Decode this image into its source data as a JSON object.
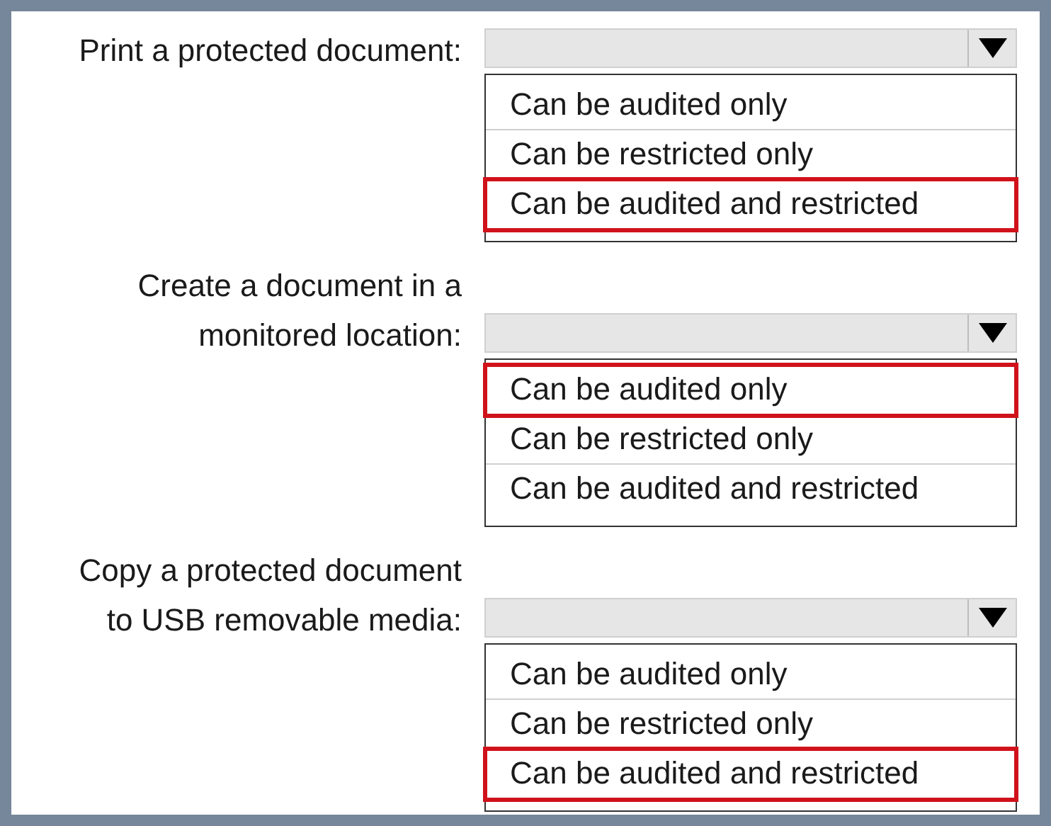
{
  "questions": [
    {
      "label": "Print a protected document:",
      "options": [
        {
          "text": "Can be audited only",
          "selected": false
        },
        {
          "text": "Can be restricted only",
          "selected": false
        },
        {
          "text": "Can be audited and restricted",
          "selected": true
        }
      ]
    },
    {
      "label": "Create a document in a\nmonitored location:",
      "options": [
        {
          "text": "Can be audited only",
          "selected": true
        },
        {
          "text": "Can be restricted only",
          "selected": false
        },
        {
          "text": "Can be audited and restricted",
          "selected": false
        }
      ]
    },
    {
      "label": "Copy a protected document\nto USB removable media:",
      "options": [
        {
          "text": "Can be audited only",
          "selected": false
        },
        {
          "text": "Can be restricted only",
          "selected": false
        },
        {
          "text": "Can be audited and restricted",
          "selected": true
        }
      ]
    }
  ]
}
